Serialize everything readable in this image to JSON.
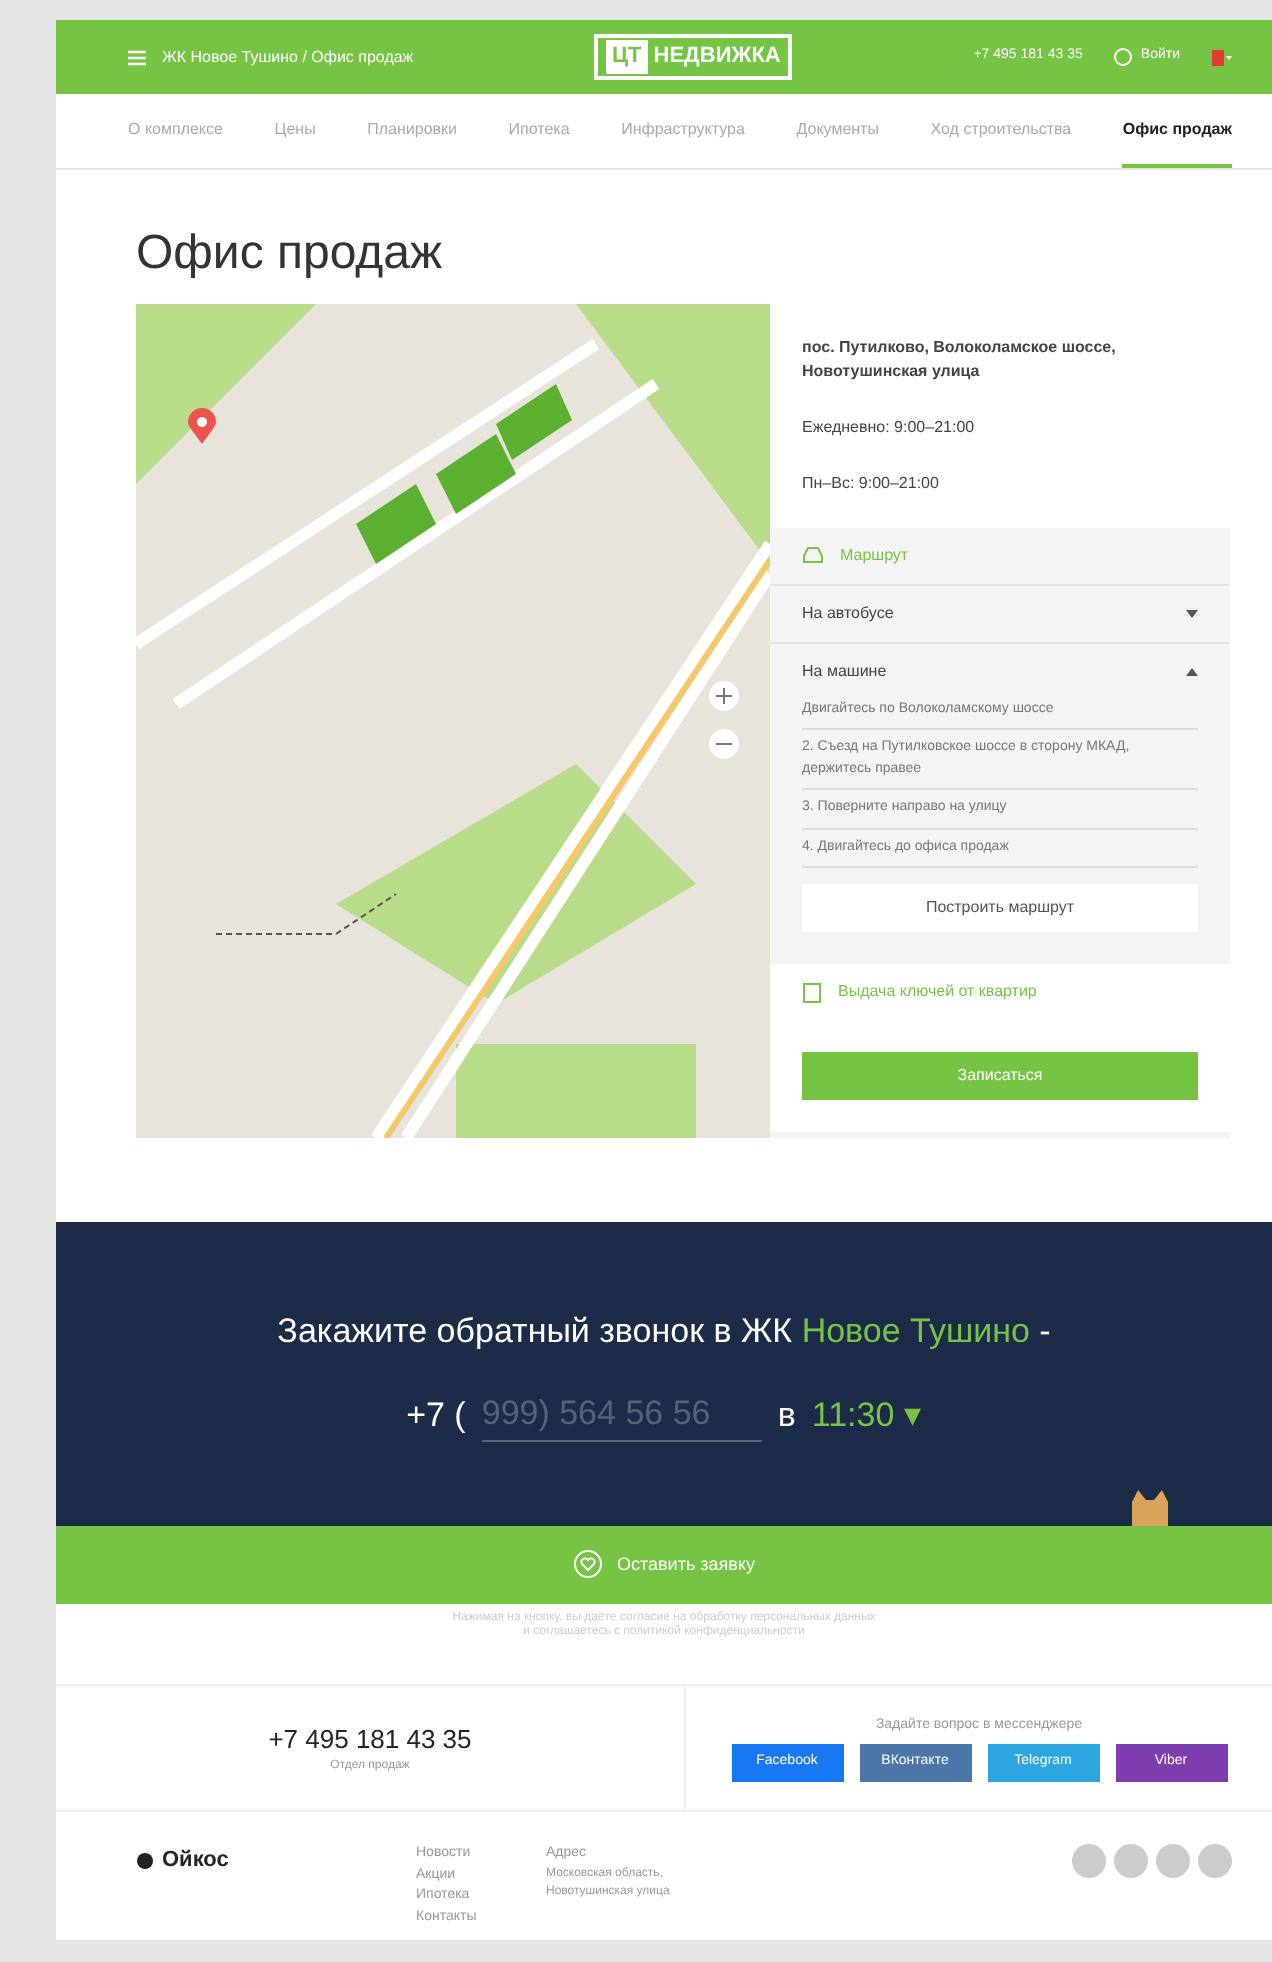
{
  "header": {
    "breadcrumb": "ЖК Новое Тушино / Офис продаж",
    "logo_mark": "ЦТ",
    "logo_text": "НЕДВИЖКА",
    "phone": "+7 495 181 43 35",
    "login": "Войти"
  },
  "tabs": [
    {
      "label": "О комплексе",
      "selected": false
    },
    {
      "label": "Цены",
      "selected": false
    },
    {
      "label": "Планировки",
      "selected": false
    },
    {
      "label": "Ипотека",
      "selected": false
    },
    {
      "label": "Инфраструктура",
      "selected": false
    },
    {
      "label": "Документы",
      "selected": false
    },
    {
      "label": "Ход строительства",
      "selected": false
    },
    {
      "label": "Офис продаж",
      "selected": true
    }
  ],
  "page_title": "Офис продаж",
  "office": {
    "address": "пос. Путилково, Волоколамское шоссе, Новотушинская улица",
    "schedule": "Ежедневно: 9:00–21:00",
    "hours": "Пн–Вс: 9:00–21:00",
    "route_title": "Маршрут",
    "routes": [
      {
        "label": "На автобусе",
        "expanded": false
      },
      {
        "label": "На машине",
        "expanded": true,
        "steps": [
          "Двигайтесь по Волоколамскому шоссе",
          "2. Съезд на Путилковское шоссе в сторону МКАД, держитесь правее",
          "3. Поверните направо на улицу",
          "4. Двигайтесь до офиса продаж"
        ]
      }
    ],
    "route_button": "Построить маршрут",
    "keys_title": "Выдача ключей от квартир",
    "signup_button": "Записаться"
  },
  "callback": {
    "text": "Закажите обратный звонок в ЖК ",
    "highlight": "Новое Тушино",
    "dash": "-",
    "prefix": "+7 (",
    "placeholder": "999) 564 56 56",
    "at": "в",
    "time": "11:30",
    "time_caret": "▾"
  },
  "submit": "Оставить заявку",
  "disclaimer": [
    "Нажимая на кнопку, вы даёте согласие на обработку персональных данных",
    "и соглашаетесь с политикой конфиденциальности"
  ],
  "contacts": {
    "phone": "+7 495 181 43 35",
    "phone_note": "Отдел продаж",
    "messenger_title": "Задайте вопрос в мессенджере",
    "messengers": [
      {
        "label": "Facebook",
        "color": "#1877f2"
      },
      {
        "label": "ВКонтакте",
        "color": "#4a76a8"
      },
      {
        "label": "Telegram",
        "color": "#2ca5e0"
      },
      {
        "label": "Viber",
        "color": "#7d3daf"
      }
    ]
  },
  "footer": {
    "logo": "Ойкос",
    "links": [
      "Новости",
      "Акции",
      "Ипотека",
      "Контакты"
    ],
    "address_title": "Адрес",
    "address": "Московская область, Новотушинская улица"
  }
}
